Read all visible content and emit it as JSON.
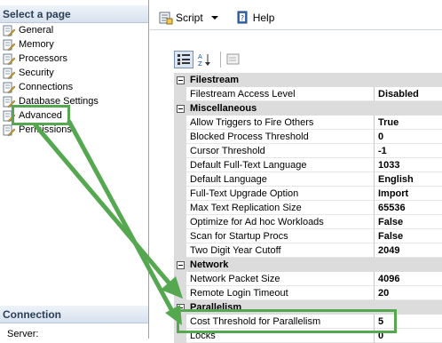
{
  "left_pane": {
    "select_page_title": "Select a page",
    "pages": [
      {
        "label": "General"
      },
      {
        "label": "Memory"
      },
      {
        "label": "Processors"
      },
      {
        "label": "Security"
      },
      {
        "label": "Connections"
      },
      {
        "label": "Database Settings"
      },
      {
        "label": "Advanced"
      },
      {
        "label": "Permissions"
      }
    ],
    "connection_title": "Connection",
    "server_label": "Server:"
  },
  "toolbar": {
    "script_label": "Script",
    "help_label": "Help"
  },
  "grid": {
    "categories": [
      {
        "name": "Filestream",
        "properties": [
          {
            "name": "Filestream Access Level",
            "value": "Disabled"
          }
        ]
      },
      {
        "name": "Miscellaneous",
        "properties": [
          {
            "name": "Allow Triggers to Fire Others",
            "value": "True"
          },
          {
            "name": "Blocked Process Threshold",
            "value": "0"
          },
          {
            "name": "Cursor Threshold",
            "value": "-1"
          },
          {
            "name": "Default Full-Text Language",
            "value": "1033"
          },
          {
            "name": "Default Language",
            "value": "English"
          },
          {
            "name": "Full-Text Upgrade Option",
            "value": "Import"
          },
          {
            "name": "Max Text Replication Size",
            "value": "65536"
          },
          {
            "name": "Optimize for Ad hoc Workloads",
            "value": "False"
          },
          {
            "name": "Scan for Startup Procs",
            "value": "False"
          },
          {
            "name": "Two Digit Year Cutoff",
            "value": "2049"
          }
        ]
      },
      {
        "name": "Network",
        "properties": [
          {
            "name": "Network Packet Size",
            "value": "4096"
          },
          {
            "name": "Remote Login Timeout",
            "value": "20"
          }
        ]
      },
      {
        "name": "Parallelism",
        "properties": [
          {
            "name": "Cost Threshold for Parallelism",
            "value": "5"
          },
          {
            "name": "Locks",
            "value": "0"
          }
        ]
      }
    ]
  },
  "colors": {
    "highlight": "#55a84f",
    "category_bg": "#dcdcdc"
  }
}
